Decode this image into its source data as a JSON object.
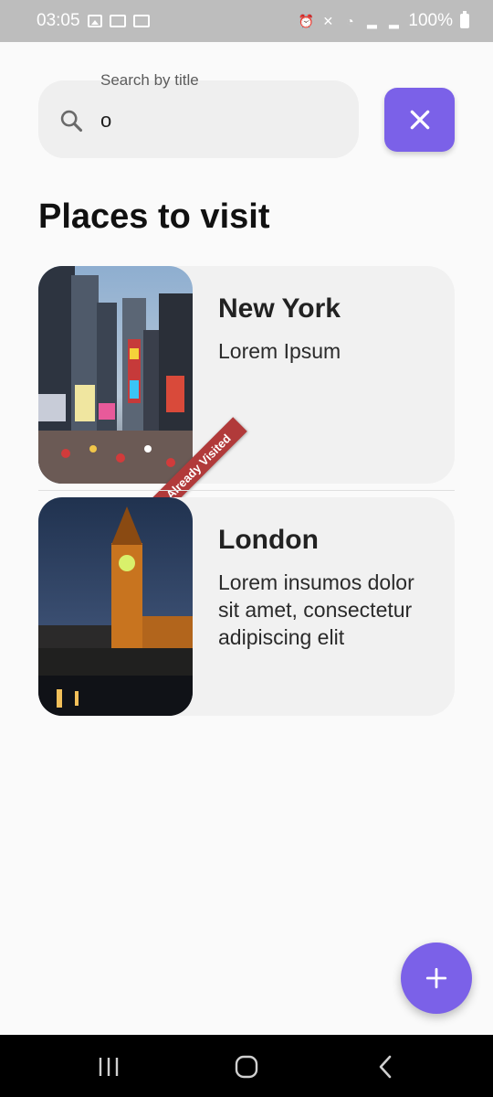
{
  "status_bar": {
    "time": "03:05",
    "battery": "100%"
  },
  "search": {
    "label": "Search by title",
    "value": "o"
  },
  "heading": {
    "bold": "Places",
    "rest": " to visit"
  },
  "places": [
    {
      "title": "New York",
      "description": "Lorem Ipsum",
      "badge": "Already Visited"
    },
    {
      "title": "London",
      "description": "Lorem insumos dolor sit amet, consectetur adipiscing elit"
    }
  ],
  "colors": {
    "accent": "#7b61e8",
    "badge": "#b13a3a",
    "card": "#f1f1f1",
    "search_bg": "#efefef"
  },
  "icons": {
    "search": "search-icon",
    "clear": "close-icon",
    "add": "plus-icon",
    "nav_recent": "recent-apps-icon",
    "nav_home": "home-icon",
    "nav_back": "back-icon"
  }
}
